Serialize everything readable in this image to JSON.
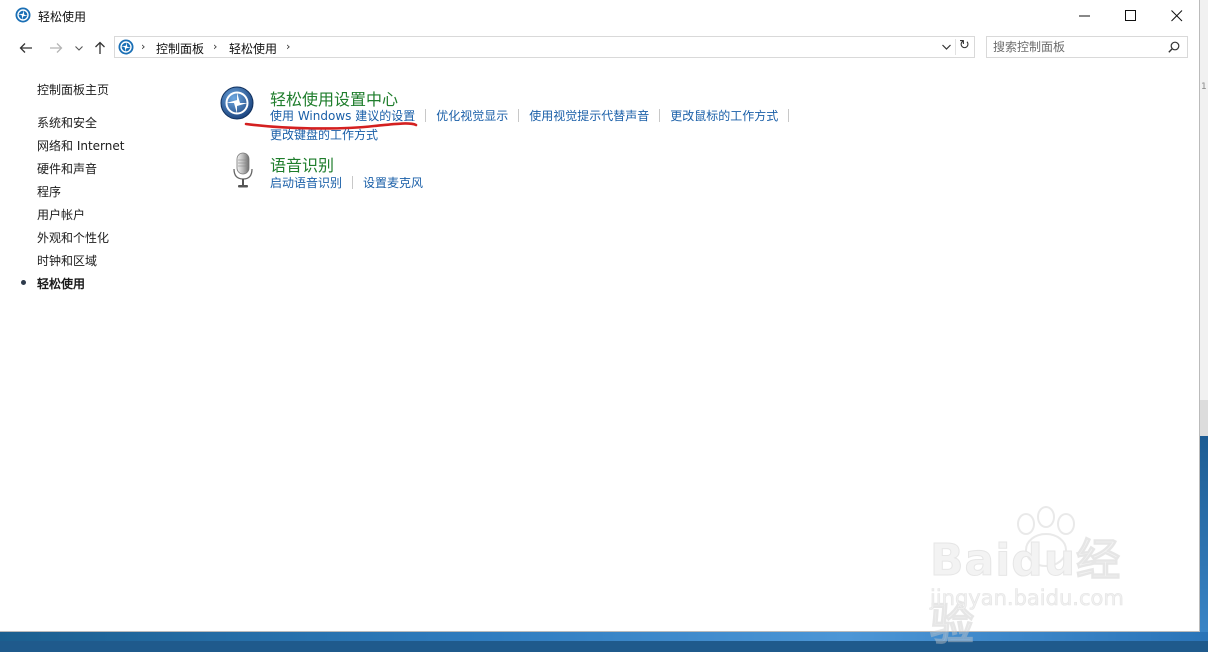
{
  "window": {
    "title": "轻松使用"
  },
  "titlebar_buttons": {
    "minimize": "minimize-icon",
    "maximize": "maximize-icon",
    "close": "close-icon"
  },
  "address": {
    "breadcrumbs": [
      "控制面板",
      "轻松使用"
    ]
  },
  "search": {
    "placeholder": "搜索控制面板"
  },
  "sidebar": {
    "home": "控制面板主页",
    "items": [
      "系统和安全",
      "网络和 Internet",
      "硬件和声音",
      "程序",
      "用户帐户",
      "外观和个性化",
      "时钟和区域",
      "轻松使用"
    ],
    "current_index": 7
  },
  "categories": [
    {
      "title": "轻松使用设置中心",
      "icon": "ease-of-access-icon",
      "tasks": [
        "使用 Windows 建议的设置",
        "优化视觉显示",
        "使用视觉提示代替声音",
        "更改鼠标的工作方式",
        "更改键盘的工作方式"
      ]
    },
    {
      "title": "语音识别",
      "icon": "microphone-icon",
      "tasks": [
        "启动语音识别",
        "设置麦克风"
      ]
    }
  ],
  "colors": {
    "category_title": "#1e7d2b",
    "task_link": "#1a5fa8",
    "annotation": "#d42020"
  },
  "watermark": {
    "main": "Baidu经验",
    "sub": "jingyan.baidu.com"
  }
}
